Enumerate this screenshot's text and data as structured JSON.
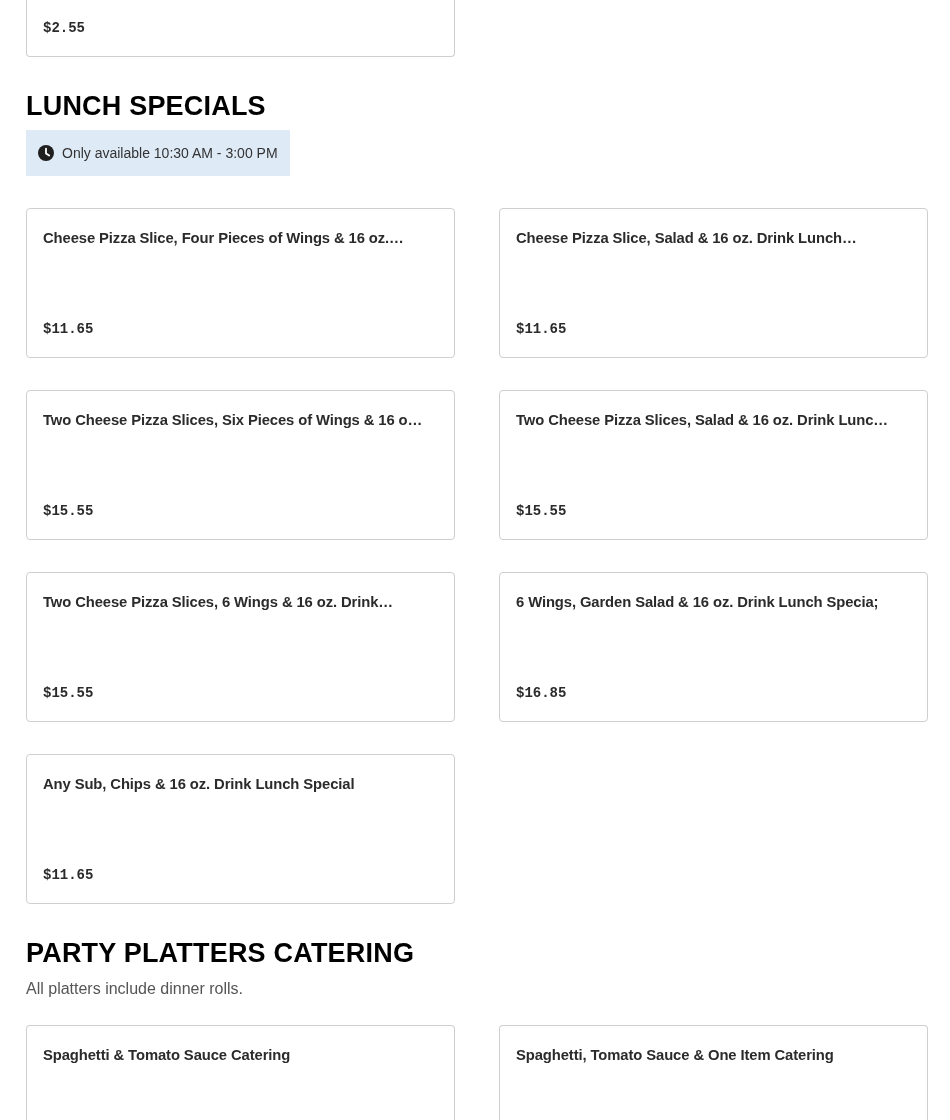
{
  "sections": [
    {
      "items": [
        {
          "price": "$2.55"
        }
      ]
    },
    {
      "title": "LUNCH SPECIALS",
      "notice": {
        "text": "Only available 10:30 AM - 3:00 PM"
      },
      "items": [
        {
          "name": "Cheese Pizza Slice, Four Pieces of Wings & 16 oz.…",
          "price": "$11.65"
        },
        {
          "name": "Cheese Pizza Slice, Salad & 16 oz. Drink Lunch…",
          "price": "$11.65"
        },
        {
          "name": "Two Cheese Pizza Slices, Six Pieces of Wings & 16 o…",
          "price": "$15.55"
        },
        {
          "name": "Two Cheese Pizza Slices, Salad & 16 oz. Drink Lunc…",
          "price": "$15.55"
        },
        {
          "name": "Two Cheese Pizza Slices, 6 Wings & 16 oz. Drink…",
          "price": "$15.55"
        },
        {
          "name": "6 Wings, Garden Salad & 16 oz. Drink Lunch Specia;",
          "price": "$16.85"
        },
        {
          "name": "Any Sub, Chips & 16 oz. Drink Lunch Special",
          "price": "$11.65"
        }
      ]
    },
    {
      "title": "PARTY PLATTERS CATERING",
      "description": "All platters include dinner rolls.",
      "items": [
        {
          "name": "Spaghetti & Tomato Sauce Catering"
        },
        {
          "name": "Spaghetti, Tomato Sauce & One Item Catering"
        }
      ]
    }
  ]
}
